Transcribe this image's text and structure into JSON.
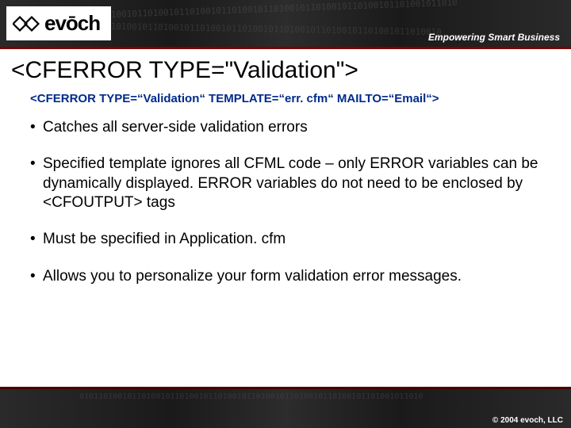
{
  "header": {
    "brand": "evōch",
    "tagline": "Empowering Smart Business"
  },
  "slide": {
    "title": "<CFERROR TYPE=\"Validation\">",
    "code": "<CFERROR TYPE=“Validation“ TEMPLATE=“err. cfm“ MAILTO=“Email“>",
    "bullets": [
      "Catches all server-side validation errors",
      "Specified template ignores all CFML code – only ERROR variables can be dynamically displayed. ERROR variables do not need to be enclosed by <CFOUTPUT> tags",
      "Must be specified in Application. cfm",
      "Allows you to personalize your form validation error messages."
    ]
  },
  "footer": {
    "copyright": "© 2004 evoch, LLC"
  }
}
